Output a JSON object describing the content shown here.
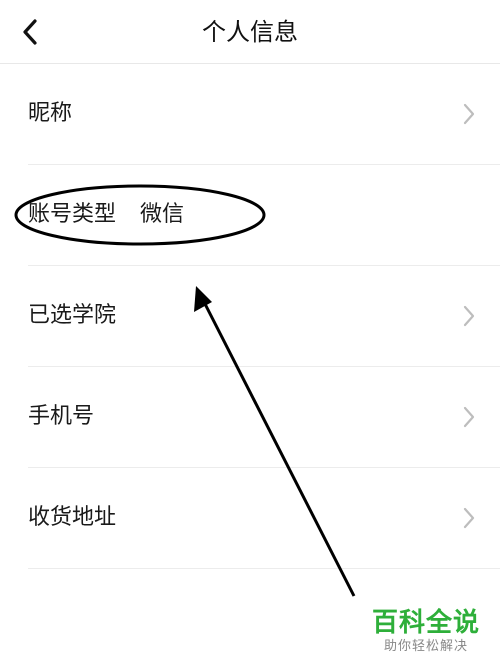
{
  "header": {
    "title": "个人信息",
    "back_icon": "chevron-left-icon"
  },
  "rows": [
    {
      "label": "昵称",
      "value": "",
      "has_chevron": true
    },
    {
      "label": "账号类型",
      "value": "微信",
      "has_chevron": false
    },
    {
      "label": "已选学院",
      "value": "",
      "has_chevron": true
    },
    {
      "label": "手机号",
      "value": "",
      "has_chevron": true
    },
    {
      "label": "收货地址",
      "value": "",
      "has_chevron": true
    }
  ],
  "watermark": {
    "main": "百科全说",
    "sub": "助你轻松解决"
  },
  "colors": {
    "watermark_green": "#2eaf3a",
    "divider": "#ececec",
    "chevron": "#bdbdbd",
    "annotation": "#000000"
  }
}
